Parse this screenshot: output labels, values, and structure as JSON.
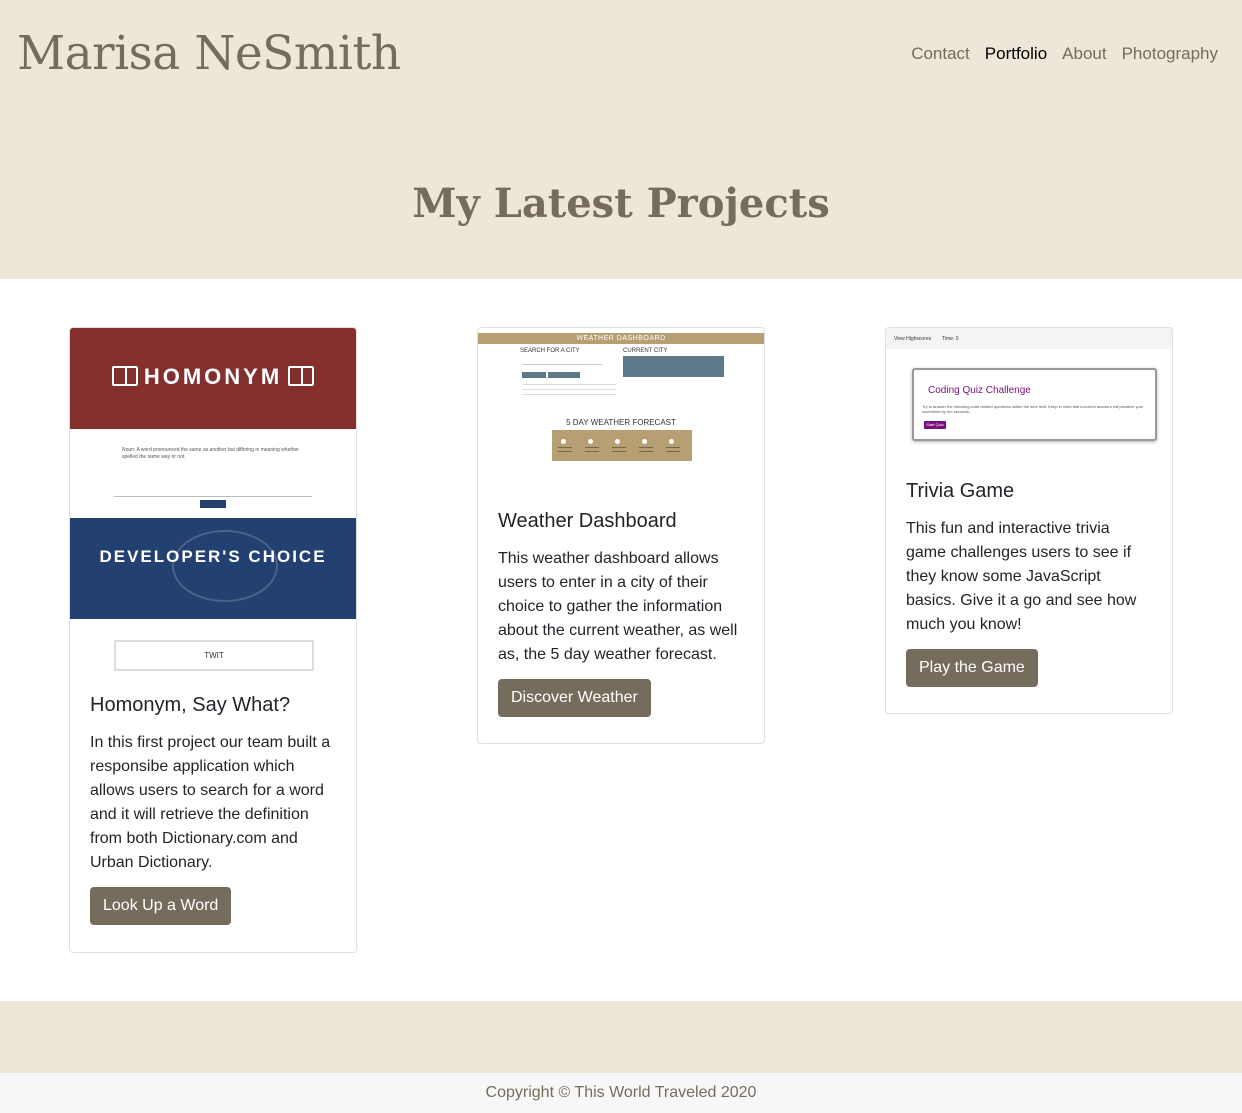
{
  "header": {
    "brand": "Marisa NeSmith",
    "nav": [
      {
        "label": "Contact"
      },
      {
        "label": "Portfolio"
      },
      {
        "label": "About"
      },
      {
        "label": "Photography"
      }
    ],
    "active_nav": "Portfolio",
    "hero_title": "My Latest Projects"
  },
  "colors": {
    "beige": "#ede6d9",
    "accent": "#766c5d",
    "homonym_red": "#822f2e",
    "homonym_blue": "#224170",
    "weather_gold": "#b59f73"
  },
  "projects": [
    {
      "title": "Homonym, Say What?",
      "description": "In this first project our team built a responsibe application which allows users to search for a word and it will retrieve the definition from both Dictionary.com and Urban Dictionary.",
      "button": "Look Up a Word",
      "thumb": {
        "banner": "HOMONYM",
        "definition": "Noun: A word pronounced the same as another but differing in meaning whether spelled the same way or not.",
        "section": "DEVELOPER'S CHOICE",
        "twit_label": "TWIT"
      }
    },
    {
      "title": "Weather Dashboard",
      "description": "This weather dashboard allows users to enter in a city of their choice to gather the information about the current weather, as well as, the 5 day weather forecast.",
      "button": "Discover Weather",
      "thumb": {
        "bar_title": "WEATHER DASHBOARD",
        "search_label": "SEARCH FOR A CITY",
        "current_label": "CURRENT CITY",
        "forecast_label": "5 DAY WEATHER FORECAST"
      }
    },
    {
      "title": "Trivia Game",
      "description": "This fun and interactive trivia game challenges users to see if they know some JavaScript basics. Give it a go and see how much you know!",
      "button": "Play the Game",
      "thumb": {
        "nav_left": "View Highscores",
        "nav_right": "Time: 0",
        "quiz_title": "Coding Quiz Challenge",
        "quiz_desc": "Try to answer the following code-related questions within the time limit. Keep in mind that incorrect answers will penalize your score/time by ten seconds!",
        "start_label": "Start Quiz"
      }
    }
  ],
  "footer": {
    "copyright": "Copyright © This World Traveled 2020"
  }
}
